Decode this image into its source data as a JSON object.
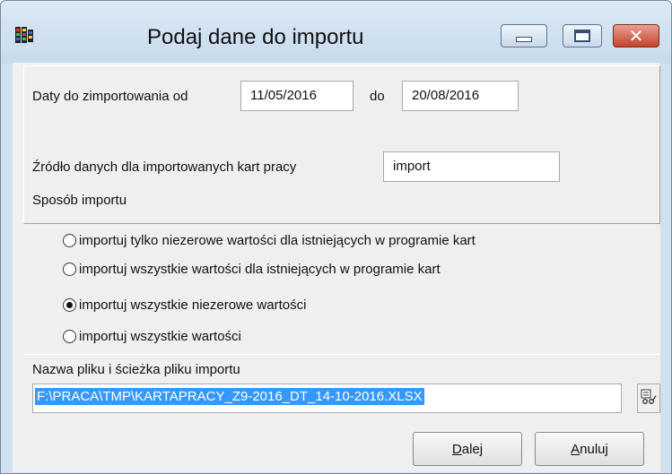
{
  "window": {
    "title": "Podaj dane do importu",
    "icon": "film-app-icon",
    "controls": {
      "minimize": "minimize-icon",
      "maximize": "maximize-icon",
      "close": "close-icon"
    }
  },
  "dates": {
    "from_label": "Daty do zimportowania od",
    "from_value": "11/05/2016",
    "to_label": "do",
    "to_value": "20/08/2016"
  },
  "source": {
    "label": "Źródło danych dla importowanych kart pracy",
    "value": "import"
  },
  "import_mode": {
    "label": "Sposób importu",
    "options": [
      {
        "label": "importuj tylko niezerowe wartości dla istniejących w programie kart",
        "selected": false
      },
      {
        "label": "importuj wszystkie wartości dla istniejących w programie kart",
        "selected": false
      },
      {
        "label": "importuj wszystkie niezerowe wartości",
        "selected": true
      },
      {
        "label": "importuj wszystkie wartości",
        "selected": false
      }
    ]
  },
  "file": {
    "label": "Nazwa pliku i ścieżka pliku importu",
    "path": "F:\\PRACA\\TMP\\KARTAPRACY_Z9-2016_DT_14-10-2016.XLSX",
    "browse_icon": "browse-file-icon"
  },
  "buttons": {
    "next_mnemonic": "D",
    "next_rest": "alej",
    "cancel_mnemonic": "A",
    "cancel_rest": "nuluj"
  },
  "colors": {
    "titlebar": "#c7dbee",
    "selection": "#3399ff",
    "close_button": "#c5442d"
  }
}
